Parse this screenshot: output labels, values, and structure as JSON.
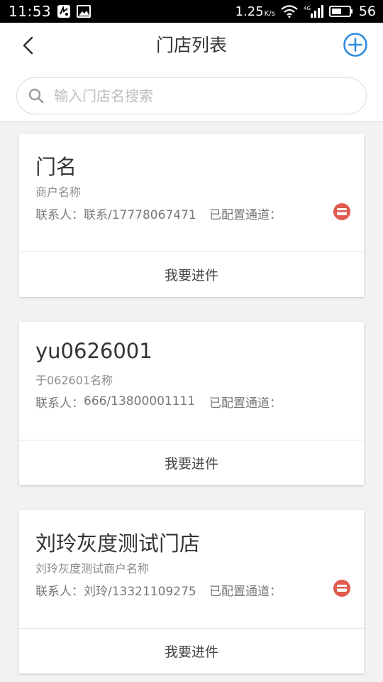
{
  "status_bar": {
    "time": "11:53",
    "speed_value": "1.25",
    "speed_unit": "K/s",
    "network_label": "4G",
    "battery": "56",
    "icons": [
      "notification-app-icon",
      "image-icon",
      "wifi-icon",
      "signal-icon",
      "battery-icon"
    ]
  },
  "header": {
    "title": "门店列表",
    "back_icon": "chevron-left-icon",
    "add_icon": "plus-circle-icon",
    "accent_color": "#2d8ae0"
  },
  "search": {
    "placeholder": "输入门店名搜索",
    "value": "",
    "icon": "search-icon"
  },
  "stores": [
    {
      "name": "门名",
      "merchant": "商户名称",
      "contact_label": "联系人：",
      "contact": "联系/17778067471",
      "channel_label": "已配置通道：",
      "has_channel_icon": true,
      "channel_icon": "card-icon",
      "channel_icon_color": "#e05a4e",
      "action_label": "我要进件"
    },
    {
      "name": "yu0626001",
      "merchant": "于062601名称",
      "contact_label": "联系人：",
      "contact": "666/13800001111",
      "channel_label": "已配置通道：",
      "has_channel_icon": false,
      "action_label": "我要进件"
    },
    {
      "name": "刘玲灰度测试门店",
      "merchant": "刘玲灰度测试商户名称",
      "contact_label": "联系人：",
      "contact": "刘玲/13321109275",
      "channel_label": "已配置通道：",
      "has_channel_icon": true,
      "channel_icon": "card-icon",
      "channel_icon_color": "#e05a4e",
      "action_label": "我要进件"
    }
  ]
}
